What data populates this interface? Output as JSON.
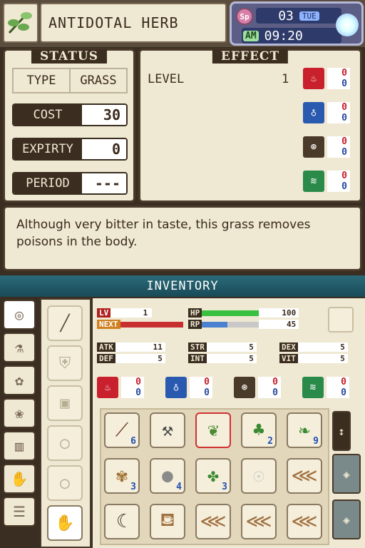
{
  "item": {
    "name": "ANTIDOTAL HERB",
    "icon": "herb-icon"
  },
  "clock": {
    "sp": "Sp",
    "day": "03",
    "weekday": "TUE",
    "ampm": "AM",
    "time": "09:20"
  },
  "status": {
    "title": "STATUS",
    "type_label": "TYPE",
    "type_value": "GRASS",
    "cost_label": "COST",
    "cost_value": "30",
    "expiry_label": "EXPIRTY",
    "expiry_value": "0",
    "period_label": "PERIOD",
    "period_value": "---"
  },
  "effect": {
    "title": "EFFECT",
    "level_label": "LEVEL",
    "level_value": "1",
    "elements": [
      {
        "icon": "fire-icon",
        "color": "#c8202c",
        "a": "0",
        "b": "0"
      },
      {
        "icon": "water-icon",
        "color": "#2a5ab0",
        "a": "0",
        "b": "0"
      },
      {
        "icon": "earth-icon",
        "color": "#4a3a2a",
        "a": "0",
        "b": "0"
      },
      {
        "icon": "wind-icon",
        "color": "#2a8a4a",
        "a": "0",
        "b": "0"
      }
    ]
  },
  "description": "Although very bitter in taste, this grass removes poisons in the body.",
  "inventory": {
    "title": "INVENTORY",
    "lv_label": "LV",
    "lv_value": "1",
    "next_label": "NEXT",
    "hp_label": "HP",
    "hp_value": "100",
    "rp_label": "RP",
    "rp_value": "45",
    "atk_label": "ATK",
    "atk_value": "11",
    "def_label": "DEF",
    "def_value": "5",
    "str_label": "STR",
    "str_value": "5",
    "int_label": "INT",
    "int_value": "5",
    "dex_label": "DEX",
    "dex_value": "5",
    "vit_label": "VIT",
    "vit_value": "5",
    "elements": [
      {
        "icon": "fire-icon",
        "color": "#c8202c",
        "a": "0",
        "b": "0"
      },
      {
        "icon": "water-icon",
        "color": "#2a5ab0",
        "a": "0",
        "b": "0"
      },
      {
        "icon": "earth-icon",
        "color": "#4a3a2a",
        "a": "0",
        "b": "0"
      },
      {
        "icon": "wind-icon",
        "color": "#2a8a4a",
        "a": "0",
        "b": "0"
      }
    ],
    "slots": [
      {
        "icon": "branch-icon",
        "qty": "6"
      },
      {
        "icon": "hoe-icon",
        "qty": ""
      },
      {
        "icon": "antidotal-herb-icon",
        "qty": ""
      },
      {
        "icon": "tree-icon",
        "qty": "2"
      },
      {
        "icon": "leaf-herb-icon",
        "qty": "9"
      },
      {
        "icon": "withered-grass-icon",
        "qty": "3"
      },
      {
        "icon": "stone-icon",
        "qty": "4"
      },
      {
        "icon": "green-herb-icon",
        "qty": "3"
      },
      {
        "icon": "turnip-icon",
        "qty": ""
      },
      {
        "icon": "fish-icon",
        "qty": ""
      },
      {
        "icon": "sickle-icon",
        "qty": ""
      },
      {
        "icon": "watering-can-icon",
        "qty": ""
      },
      {
        "icon": "fish-icon",
        "qty": ""
      },
      {
        "icon": "fish-icon",
        "qty": ""
      },
      {
        "icon": "fish-icon",
        "qty": ""
      }
    ]
  }
}
